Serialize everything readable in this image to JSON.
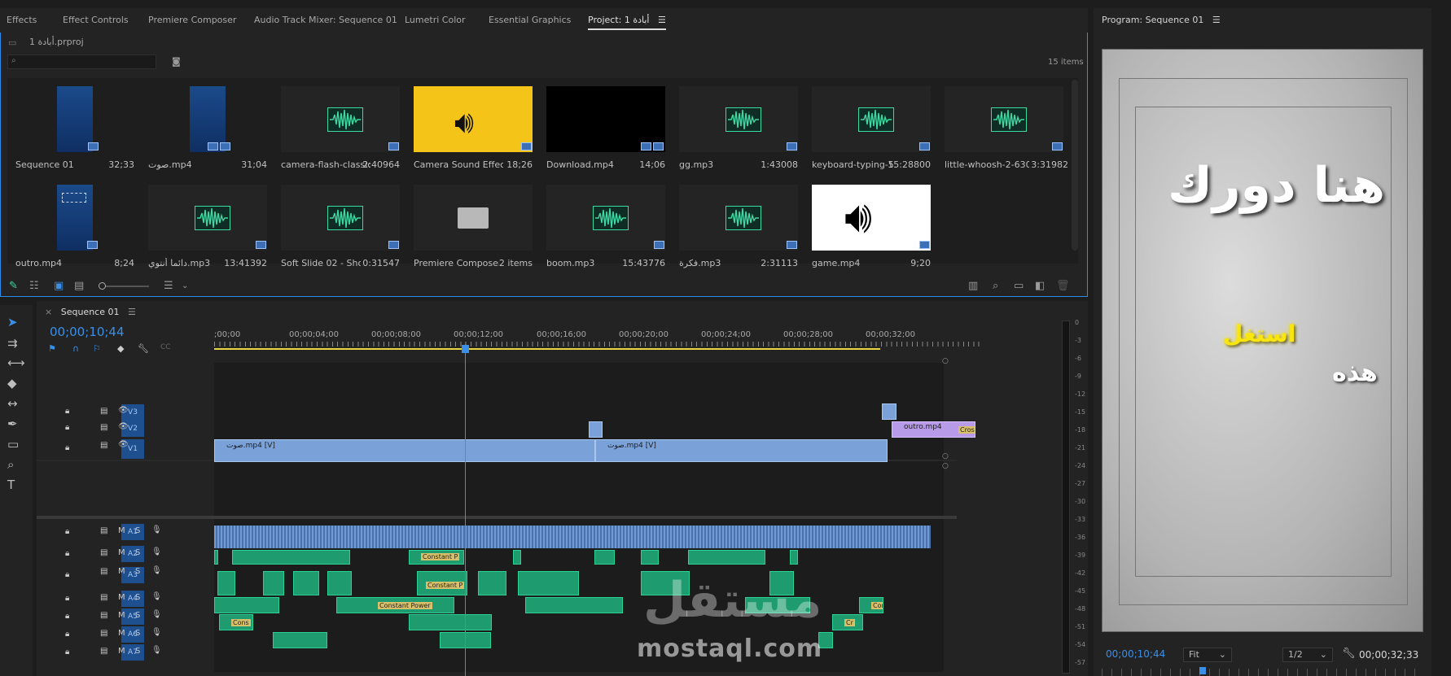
{
  "tabs": [
    {
      "label": "Effects",
      "active": false
    },
    {
      "label": "Effect Controls",
      "active": false
    },
    {
      "label": "Premiere Composer",
      "active": false
    },
    {
      "label": "Audio Track Mixer: Sequence 01",
      "active": false
    },
    {
      "label": "Lumetri Color",
      "active": false
    },
    {
      "label": "Essential Graphics",
      "active": false
    },
    {
      "label": "Project: أبادة 1",
      "active": true
    }
  ],
  "project": {
    "file_name": "أبادة 1.prproj",
    "search_placeholder": "",
    "item_count": "15 items",
    "items": [
      {
        "name": "Sequence 01",
        "duration": "32;33",
        "type": "video"
      },
      {
        "name": "صوت.mp4",
        "duration": "31;04",
        "type": "video"
      },
      {
        "name": "camera-flash-classic...",
        "duration": "2:40964",
        "type": "audio"
      },
      {
        "name": "Camera Sound Effects ...",
        "duration": "18;26",
        "type": "yellow"
      },
      {
        "name": "Download.mp4",
        "duration": "14;06",
        "type": "black"
      },
      {
        "name": "gg.mp3",
        "duration": "1:43008",
        "type": "audio"
      },
      {
        "name": "keyboard-typing-5...",
        "duration": "15:28800",
        "type": "audio"
      },
      {
        "name": "little-whoosh-2-6301...",
        "duration": "3:31982",
        "type": "audio"
      },
      {
        "name": "outro.mp4",
        "duration": "8;24",
        "type": "video"
      },
      {
        "name": "دائما أنتوي.mp3",
        "duration": "13:41392",
        "type": "audio"
      },
      {
        "name": "Soft Slide 02 - Short...",
        "duration": "0:31547",
        "type": "audio"
      },
      {
        "name": "Premiere Composer",
        "duration": "2 items",
        "type": "folder"
      },
      {
        "name": "boom.mp3",
        "duration": "15:43776",
        "type": "audio"
      },
      {
        "name": "فكرة.mp3",
        "duration": "2:31113",
        "type": "audio"
      },
      {
        "name": "game.mp4",
        "duration": "9;20",
        "type": "white"
      }
    ]
  },
  "program": {
    "title": "Program: Sequence 01",
    "overlay_line1": "هنا دورك",
    "overlay_line2": "استغل",
    "overlay_line3": "هذه",
    "current_time": "00;00;10;44",
    "fit": "Fit",
    "resolution": "1/2",
    "duration": "00;00;32;33"
  },
  "timeline": {
    "sequence_name": "Sequence 01",
    "timecode": "00;00;10;44",
    "ruler": [
      ";00;00",
      "00;00;04;00",
      "00;00;08;00",
      "00;00;12;00",
      "00;00;16;00",
      "00;00;20;00",
      "00;00;24;00",
      "00;00;28;00",
      "00;00;32;00"
    ],
    "video_tracks": [
      "V3",
      "V2",
      "V1"
    ],
    "audio_tracks": [
      "A1",
      "A2",
      "A3",
      "A4",
      "A5",
      "A6",
      "A7"
    ],
    "clip_v1_a": "صوت.mp4 [V]",
    "clip_v1_b": "صوت.mp4 [V]",
    "clip_v2": "outro.mp4",
    "clip_v2_tag": "Cross",
    "fx_constant_power": "Constant Power",
    "fx_constant_p": "Constant P",
    "fx_cons": "Cons",
    "fx_cross": "Cros",
    "fx_cr": "Cr"
  },
  "meter_labels": [
    "0",
    "-3",
    "-6",
    "-9",
    "-12",
    "-15",
    "-18",
    "-21",
    "-24",
    "-27",
    "-30",
    "-33",
    "-36",
    "-39",
    "-42",
    "-45",
    "-48",
    "-51",
    "-54",
    "-57"
  ],
  "watermark": {
    "text": "mostaql.com",
    "arabic": "مستقل"
  },
  "colors": {
    "accent": "#3a8fe6",
    "audio_clip": "#1e9c6f",
    "video_clip": "#7aa2d8",
    "purple_clip": "#b79ae8",
    "yellow_text": "#f9e50f"
  }
}
